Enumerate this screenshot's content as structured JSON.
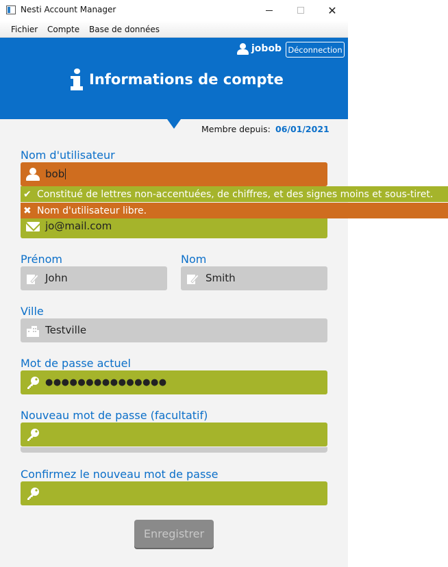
{
  "window": {
    "title": "Nesti Account Manager",
    "controls": {
      "minimize": "",
      "maximize": "",
      "close": "✕"
    }
  },
  "menubar": {
    "items": [
      {
        "label": "Fichier"
      },
      {
        "label": "Compte"
      },
      {
        "label": "Base de données"
      }
    ]
  },
  "header": {
    "username": "jobob",
    "logout_label": "Déconnection",
    "title": "Informations de compte",
    "color": "#0b6fc9"
  },
  "member": {
    "label": "Membre depuis:",
    "date": "06/01/2021"
  },
  "form": {
    "username": {
      "label": "Nom d'utilisateur",
      "value": "bob",
      "icon": "user-icon",
      "state": "error"
    },
    "email": {
      "value": "jo@mail.com",
      "icon": "mail-icon",
      "state": "valid"
    },
    "firstname": {
      "label": "Prénom",
      "value": "John",
      "icon": "edit-icon",
      "state": "readonly"
    },
    "lastname": {
      "label": "Nom",
      "value": "Smith",
      "icon": "edit-icon",
      "state": "readonly"
    },
    "city": {
      "label": "Ville",
      "value": "Testville",
      "icon": "city-icon",
      "state": "readonly"
    },
    "current_password": {
      "label": "Mot de passe actuel",
      "value": "●●●●●●●●●●●●●●●",
      "icon": "key-icon",
      "state": "valid"
    },
    "new_password": {
      "label": "Nouveau mot de passe (facultatif)",
      "value": "",
      "icon": "key-icon",
      "state": "valid"
    },
    "confirm_password": {
      "label": "Confirmez le nouveau mot de passe",
      "value": "",
      "icon": "key-icon",
      "state": "valid"
    },
    "save_label": "Enregistrer"
  },
  "validation": {
    "ok_icon": "✔",
    "ok_message": "Constitué de lettres non-accentuées, de chiffres, et des signes moins et sous-tiret.",
    "err_icon": "✖",
    "err_message": "Nom d'utilisateur libre."
  },
  "colors": {
    "error": "#cf6d1f",
    "valid": "#a5b42b",
    "readonly": "#cbcbcb",
    "accent": "#0b6fc9"
  }
}
